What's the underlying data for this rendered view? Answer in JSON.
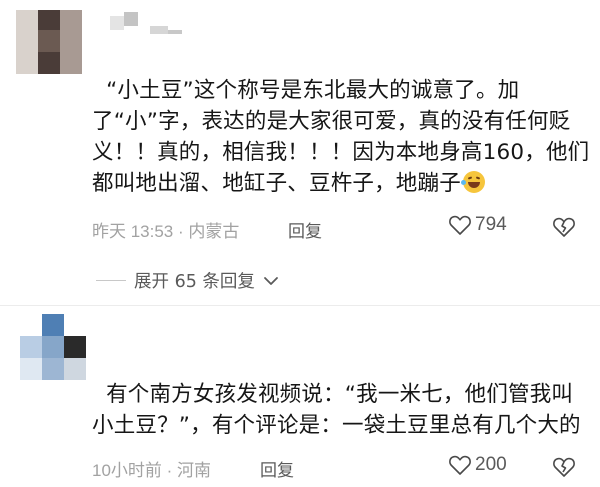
{
  "comments": [
    {
      "text": "“小土豆”这个称号是东北最大的诚意了。加了“小”字，表达的是大家很可爱，真的没有任何贬义！！真的，相信我！！！因为本地身高160，他们都叫地出溜、地缸子、豆杵子，地蹦子",
      "time": "昨天 13:53 · 内蒙古",
      "reply_label": "回复",
      "likes": "794",
      "avatar_icon": "pixelated-avatar",
      "name_icon": "pixelated-username"
    },
    {
      "text": "有个南方女孩发视频说：“我一米七，他们管我叫小土豆？”，有个评论是：一袋土豆里总有几个大的",
      "time": "10小时前 · 河南",
      "reply_label": "回复",
      "likes": "200",
      "avatar_icon": "pixelated-avatar",
      "name_icon": "pixelated-username"
    }
  ],
  "expand": {
    "label": "展开 65 条回复"
  },
  "icons": {
    "like": "heart-outline-icon",
    "dislike": "broken-heart-icon",
    "expand": "chevron-down-icon",
    "emoji": "laugh-cry-emoji"
  }
}
